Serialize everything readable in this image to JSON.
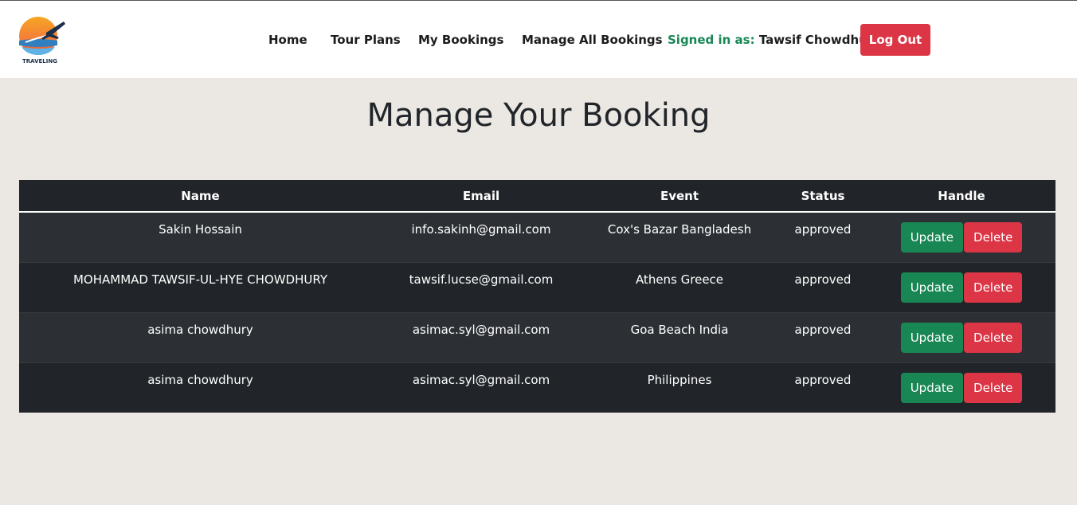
{
  "logo": {
    "text": "TRAVELING"
  },
  "nav": {
    "home": "Home",
    "tour_plans": "Tour Plans",
    "my_bookings": "My Bookings",
    "manage_all": "Manage All Bookings",
    "signed_label": "Signed in as:",
    "user_name": "Tawsif Chowdhury",
    "logout": "Log Out"
  },
  "page": {
    "title": "Manage Your Booking"
  },
  "table": {
    "headers": [
      "Name",
      "Email",
      "Event",
      "Status",
      "Handle"
    ],
    "rows": [
      {
        "name": "Sakin Hossain",
        "email": "info.sakinh@gmail.com",
        "event": "Cox's Bazar Bangladesh",
        "status": "approved",
        "update": "Update",
        "delete": "Delete"
      },
      {
        "name": "MOHAMMAD TAWSIF-UL-HYE CHOWDHURY",
        "email": "tawsif.lucse@gmail.com",
        "event": "Athens Greece",
        "status": "approved",
        "update": "Update",
        "delete": "Delete"
      },
      {
        "name": "asima chowdhury",
        "email": "asimac.syl@gmail.com",
        "event": "Goa Beach India",
        "status": "approved",
        "update": "Update",
        "delete": "Delete"
      },
      {
        "name": "asima chowdhury",
        "email": "asimac.syl@gmail.com",
        "event": "Philippines",
        "status": "approved",
        "update": "Update",
        "delete": "Delete"
      }
    ]
  },
  "colors": {
    "page_bg": "#ebe8e3",
    "table_dark": "#212529",
    "table_stripe": "#2c3034",
    "success": "#198754",
    "danger": "#dc3545"
  }
}
